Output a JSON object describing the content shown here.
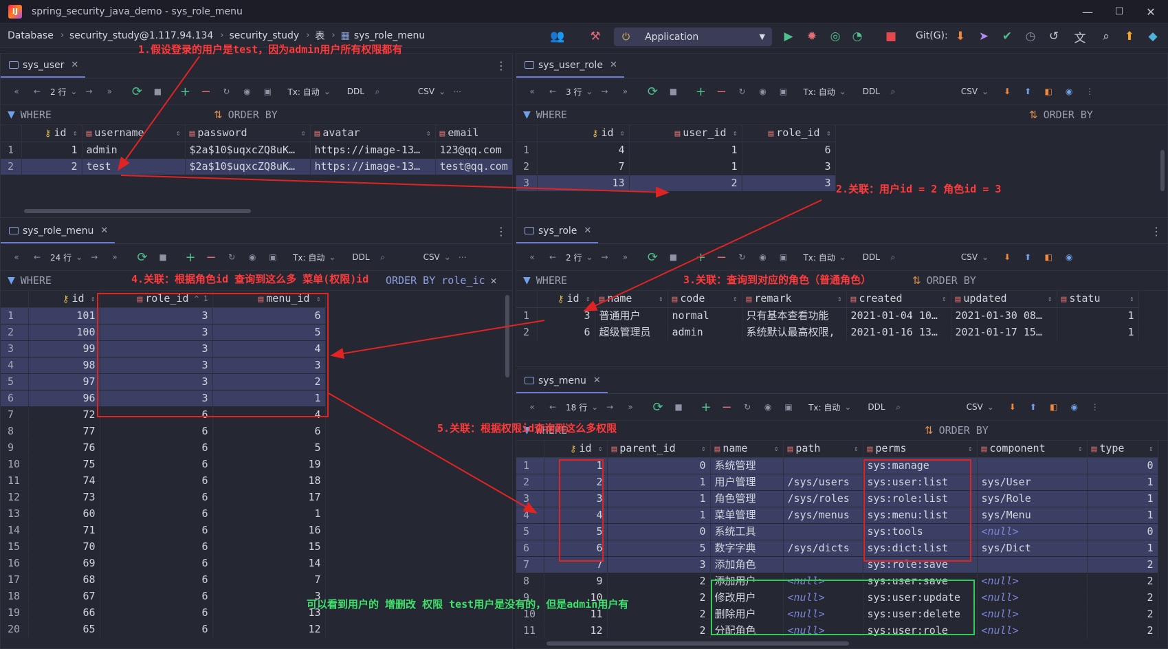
{
  "window": {
    "title": "spring_security_java_demo - sys_role_menu",
    "logo_text": "IJ",
    "min": "—",
    "max": "☐",
    "close": "✕"
  },
  "nav": {
    "crumbs": [
      "Database",
      "security_study@1.117.94.134",
      "security_study",
      "表",
      "sys_role_menu"
    ],
    "run_config": "Application",
    "git_label": "Git(G):"
  },
  "panels": {
    "sys_user": {
      "tab": "sys_user",
      "rows_label": "2 行",
      "tx": "Tx: 自动",
      "ddl": "DDL",
      "csv": "CSV",
      "where": "WHERE",
      "order_by": "ORDER BY",
      "columns": [
        "id",
        "username",
        "password",
        "avatar",
        "email"
      ],
      "rows": [
        {
          "n": "1",
          "id": "1",
          "username": "admin",
          "password": "$2a$10$uqxcZQ8uK…",
          "avatar": "https://image-13…",
          "email": "123@qq.com"
        },
        {
          "n": "2",
          "id": "2",
          "username": "test",
          "password": "$2a$10$uqxcZQ8uK…",
          "avatar": "https://image-13…",
          "email": "test@qq.com"
        }
      ]
    },
    "sys_user_role": {
      "tab": "sys_user_role",
      "rows_label": "3 行",
      "tx": "Tx: 自动",
      "ddl": "DDL",
      "csv": "CSV",
      "where": "WHERE",
      "order_by": "ORDER BY",
      "columns": [
        "id",
        "user_id",
        "role_id"
      ],
      "rows": [
        {
          "n": "1",
          "id": "4",
          "user_id": "1",
          "role_id": "6"
        },
        {
          "n": "2",
          "id": "7",
          "user_id": "1",
          "role_id": "3"
        },
        {
          "n": "3",
          "id": "13",
          "user_id": "2",
          "role_id": "3"
        }
      ]
    },
    "sys_role_menu": {
      "tab": "sys_role_menu",
      "rows_label": "24 行",
      "tx": "Tx: 自动",
      "ddl": "DDL",
      "csv": "CSV",
      "where": "WHERE",
      "order_by": "ORDER BY role_ic",
      "columns": [
        "id",
        "role_id",
        "menu_id"
      ],
      "role_sort_label": "1",
      "rows": [
        {
          "n": "1",
          "id": "101",
          "role_id": "3",
          "menu_id": "6"
        },
        {
          "n": "2",
          "id": "100",
          "role_id": "3",
          "menu_id": "5"
        },
        {
          "n": "3",
          "id": "99",
          "role_id": "3",
          "menu_id": "4"
        },
        {
          "n": "4",
          "id": "98",
          "role_id": "3",
          "menu_id": "3"
        },
        {
          "n": "5",
          "id": "97",
          "role_id": "3",
          "menu_id": "2"
        },
        {
          "n": "6",
          "id": "96",
          "role_id": "3",
          "menu_id": "1"
        },
        {
          "n": "7",
          "id": "72",
          "role_id": "6",
          "menu_id": "4"
        },
        {
          "n": "8",
          "id": "77",
          "role_id": "6",
          "menu_id": "6"
        },
        {
          "n": "9",
          "id": "76",
          "role_id": "6",
          "menu_id": "5"
        },
        {
          "n": "10",
          "id": "75",
          "role_id": "6",
          "menu_id": "19"
        },
        {
          "n": "11",
          "id": "74",
          "role_id": "6",
          "menu_id": "18"
        },
        {
          "n": "12",
          "id": "73",
          "role_id": "6",
          "menu_id": "17"
        },
        {
          "n": "13",
          "id": "60",
          "role_id": "6",
          "menu_id": "1"
        },
        {
          "n": "14",
          "id": "71",
          "role_id": "6",
          "menu_id": "16"
        },
        {
          "n": "15",
          "id": "70",
          "role_id": "6",
          "menu_id": "15"
        },
        {
          "n": "16",
          "id": "69",
          "role_id": "6",
          "menu_id": "14"
        },
        {
          "n": "17",
          "id": "68",
          "role_id": "6",
          "menu_id": "7"
        },
        {
          "n": "18",
          "id": "67",
          "role_id": "6",
          "menu_id": "3"
        },
        {
          "n": "19",
          "id": "66",
          "role_id": "6",
          "menu_id": "13"
        },
        {
          "n": "20",
          "id": "65",
          "role_id": "6",
          "menu_id": "12"
        }
      ]
    },
    "sys_role": {
      "tab": "sys_role",
      "rows_label": "2 行",
      "tx": "Tx: 自动",
      "ddl": "DDL",
      "csv": "CSV",
      "where": "WHERE",
      "order_by": "ORDER BY",
      "columns": [
        "id",
        "name",
        "code",
        "remark",
        "created",
        "updated",
        "statu"
      ],
      "rows": [
        {
          "n": "1",
          "id": "3",
          "name": "普通用户",
          "code": "normal",
          "remark": "只有基本查看功能",
          "created": "2021-01-04 10…",
          "updated": "2021-01-30 08…",
          "statu": "1"
        },
        {
          "n": "2",
          "id": "6",
          "name": "超级管理员",
          "code": "admin",
          "remark": "系统默认最高权限,",
          "created": "2021-01-16 13…",
          "updated": "2021-01-17 15…",
          "statu": "1"
        }
      ]
    },
    "sys_menu": {
      "tab": "sys_menu",
      "rows_label": "18 行",
      "tx": "Tx: 自动",
      "ddl": "DDL",
      "csv": "CSV",
      "where": "WHERE",
      "order_by": "ORDER BY",
      "columns": [
        "id",
        "parent_id",
        "name",
        "path",
        "perms",
        "component",
        "type"
      ],
      "rows": [
        {
          "n": "1",
          "id": "1",
          "parent_id": "0",
          "name": "系统管理",
          "path": "",
          "perms": "sys:manage",
          "component": "",
          "type": "0"
        },
        {
          "n": "2",
          "id": "2",
          "parent_id": "1",
          "name": "用户管理",
          "path": "/sys/users",
          "perms": "sys:user:list",
          "component": "sys/User",
          "type": "1"
        },
        {
          "n": "3",
          "id": "3",
          "parent_id": "1",
          "name": "角色管理",
          "path": "/sys/roles",
          "perms": "sys:role:list",
          "component": "sys/Role",
          "type": "1"
        },
        {
          "n": "4",
          "id": "4",
          "parent_id": "1",
          "name": "菜单管理",
          "path": "/sys/menus",
          "perms": "sys:menu:list",
          "component": "sys/Menu",
          "type": "1"
        },
        {
          "n": "5",
          "id": "5",
          "parent_id": "0",
          "name": "系统工具",
          "path": "",
          "perms": "sys:tools",
          "component": "<null>",
          "type": "0"
        },
        {
          "n": "6",
          "id": "6",
          "parent_id": "5",
          "name": "数字字典",
          "path": "/sys/dicts",
          "perms": "sys:dict:list",
          "component": "sys/Dict",
          "type": "1"
        },
        {
          "n": "7",
          "id": "7",
          "parent_id": "3",
          "name": "添加角色",
          "path": "",
          "perms": "sys:role:save",
          "component": "",
          "type": "2"
        },
        {
          "n": "8",
          "id": "9",
          "parent_id": "2",
          "name": "添加用户",
          "path": "<null>",
          "perms": "sys:user:save",
          "component": "<null>",
          "type": "2"
        },
        {
          "n": "9",
          "id": "10",
          "parent_id": "2",
          "name": "修改用户",
          "path": "<null>",
          "perms": "sys:user:update",
          "component": "<null>",
          "type": "2"
        },
        {
          "n": "10",
          "id": "11",
          "parent_id": "2",
          "name": "删除用户",
          "path": "<null>",
          "perms": "sys:user:delete",
          "component": "<null>",
          "type": "2"
        },
        {
          "n": "11",
          "id": "12",
          "parent_id": "2",
          "name": "分配角色",
          "path": "<null>",
          "perms": "sys:user:role",
          "component": "<null>",
          "type": "2"
        }
      ]
    }
  },
  "annotations": {
    "a1": "1.假设登录的用户是test，因为admin用户所有权限都有",
    "a2": "2.关联：用户id = 2 角色id = 3",
    "a3": "3.关联：查询到对应的角色（普通角色）",
    "a4": "4.关联：根据角色id 查询到这么多 菜单(权限)id",
    "a5": "5.关联：根据权限id查询到这么多权限",
    "a6": "可以看到用户的 增删改 权限 test用户是没有的，但是admin用户有"
  },
  "colors": {
    "annotation_red": "#ff3b3b",
    "annotation_green": "#3fe06a",
    "selection": "#3a3f63",
    "null_text": "#7c85d8"
  }
}
